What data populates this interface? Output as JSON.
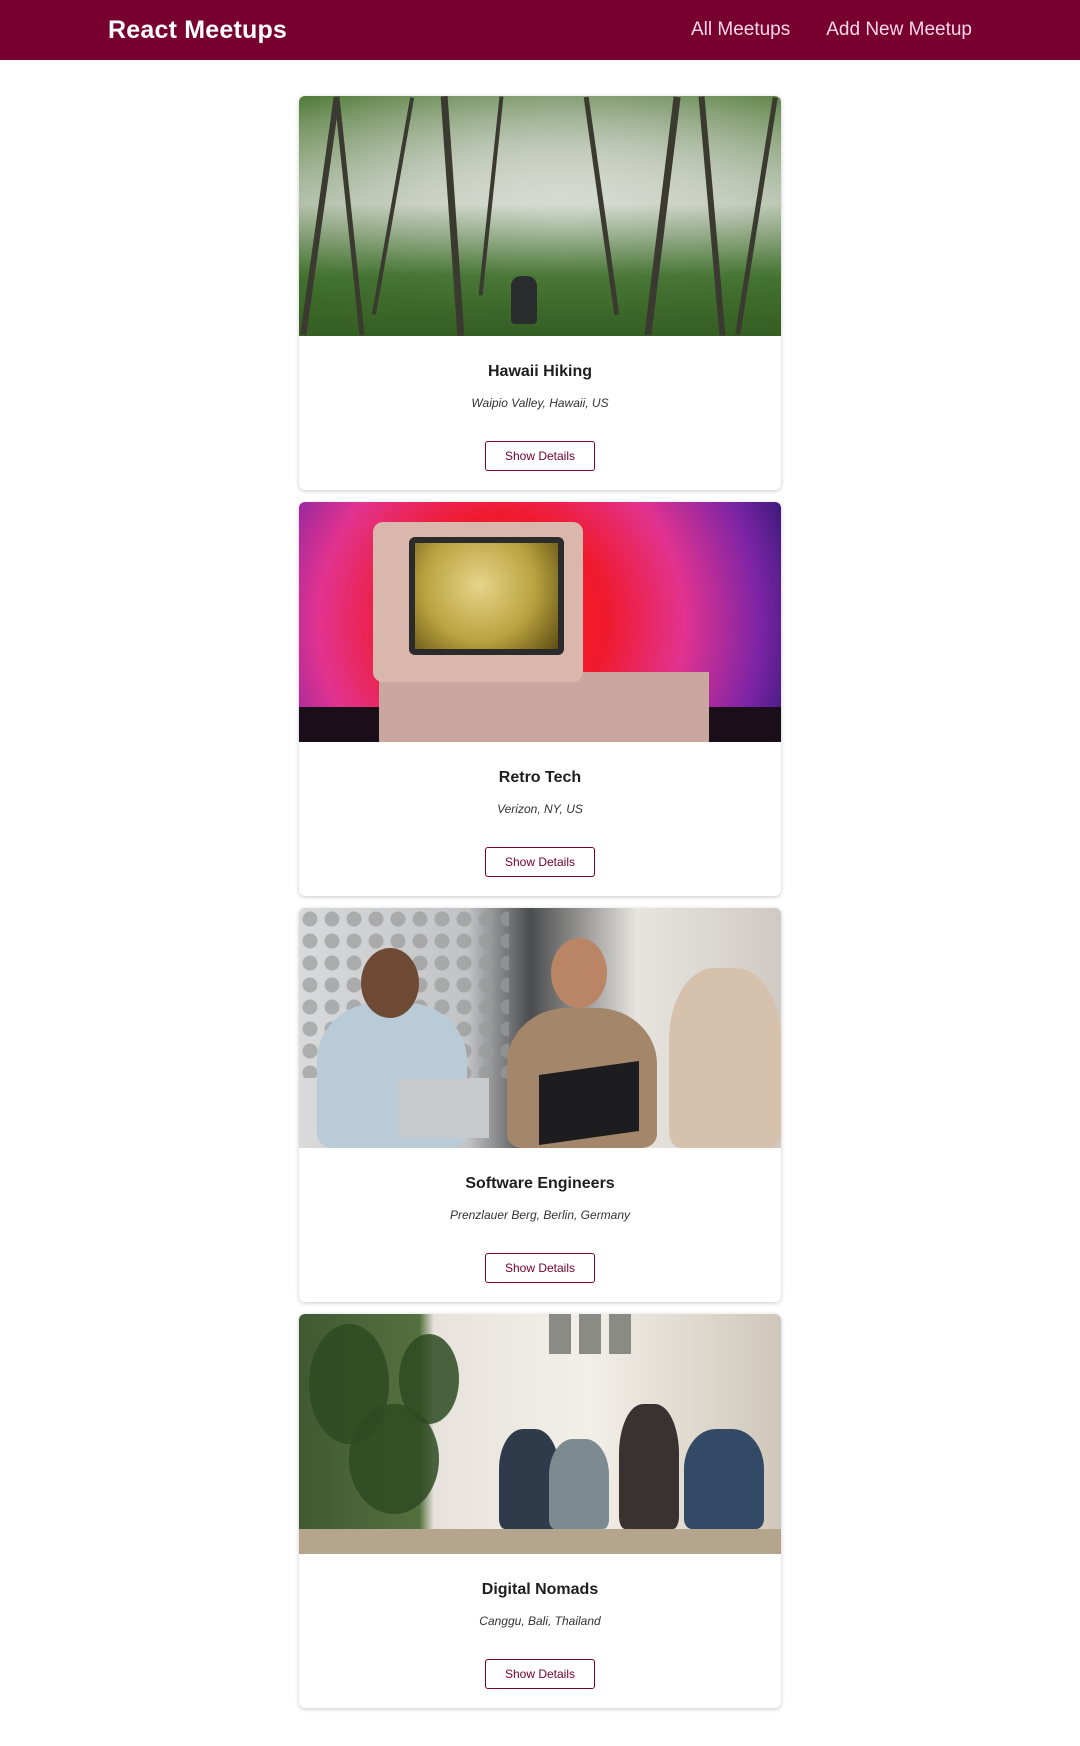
{
  "header": {
    "logo": "React Meetups",
    "nav": {
      "all_meetups": "All Meetups",
      "add_new_meetup": "Add New Meetup"
    }
  },
  "colors": {
    "brand": "#77002e",
    "nav_text": "#fcd7e6"
  },
  "meetups": [
    {
      "title": "Hawaii Hiking",
      "address": "Waipio Valley, Hawaii, US",
      "button": "Show Details",
      "image": "forest-hiking-photo"
    },
    {
      "title": "Retro Tech",
      "address": "Verizon, NY, US",
      "button": "Show Details",
      "image": "retro-computer-photo"
    },
    {
      "title": "Software Engineers",
      "address": "Prenzlauer Berg, Berlin, Germany",
      "button": "Show Details",
      "image": "office-meeting-photo"
    },
    {
      "title": "Digital Nomads",
      "address": "Canggu, Bali, Thailand",
      "button": "Show Details",
      "image": "coworking-photo"
    }
  ]
}
